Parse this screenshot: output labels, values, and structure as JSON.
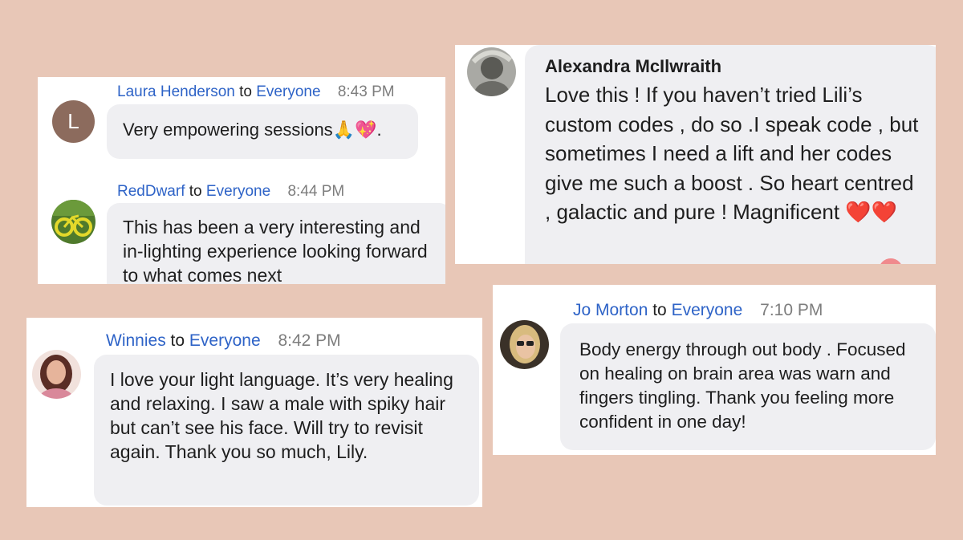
{
  "cards": [
    {
      "messages": [
        {
          "sender": "Laura Henderson",
          "to_word": "to",
          "recipient": "Everyone",
          "time": "8:43 PM",
          "avatar_letter": "L",
          "text": "Very empowering sessions🙏💖."
        },
        {
          "sender": "RedDwarf",
          "to_word": "to",
          "recipient": "Everyone",
          "time": "8:44 PM",
          "avatar_icon": "bicycle-photo-icon",
          "text": "This has been a very interesting and in-lighting experience looking forward to what comes next"
        }
      ]
    },
    {
      "messages": [
        {
          "sender": "Alexandra McIlwraith",
          "avatar_icon": "person-photo-icon",
          "text": "Love this ! If you haven’t tried Lili’s custom codes , do so .I speak code , but sometimes I need a lift and her codes give me such a boost . So heart centred , galactic and pure ! Magnificent",
          "hearts": "❤️❤️"
        }
      ]
    },
    {
      "messages": [
        {
          "sender": "Winnies",
          "to_word": "to",
          "recipient": "Everyone",
          "time": "8:42 PM",
          "avatar_icon": "woman-photo-icon",
          "text": "I love your light language. It’s very healing and relaxing. I saw a male with spiky hair but can’t see his face. Will try to revisit again. Thank you so much, Lily."
        }
      ]
    },
    {
      "messages": [
        {
          "sender": "Jo Morton",
          "to_word": "to",
          "recipient": "Everyone",
          "time": "7:10 PM",
          "avatar_icon": "woman-sunglasses-photo-icon",
          "text": "Body energy through out body . Focused on healing on brain area was warn and fingers tingling. Thank you feeling more confident in one day!"
        }
      ]
    }
  ],
  "colors": {
    "background": "#e8c7b7",
    "card": "#ffffff",
    "bubble": "#efeff2",
    "link": "#2e63c7",
    "time": "#7d7d7d"
  }
}
